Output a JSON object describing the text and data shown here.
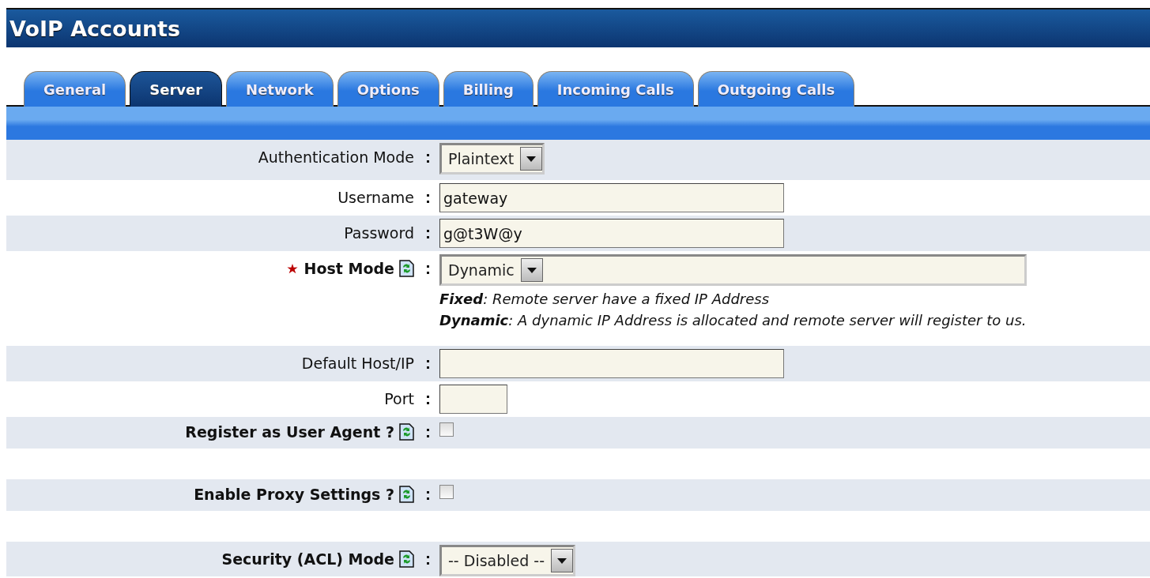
{
  "window": {
    "title": "VoIP Accounts"
  },
  "tabs": [
    {
      "label": "General",
      "selected": false
    },
    {
      "label": "Server",
      "selected": true
    },
    {
      "label": "Network",
      "selected": false
    },
    {
      "label": "Options",
      "selected": false
    },
    {
      "label": "Billing",
      "selected": false
    },
    {
      "label": "Incoming Calls",
      "selected": false
    },
    {
      "label": "Outgoing Calls",
      "selected": false
    }
  ],
  "fields": [
    {
      "kind": "select",
      "label": "Authentication Mode",
      "bold": false,
      "required": false,
      "help": false,
      "value": "Plaintext"
    },
    {
      "kind": "text",
      "label": "Username",
      "bold": false,
      "required": false,
      "help": false,
      "value": "gateway"
    },
    {
      "kind": "text",
      "label": "Password",
      "bold": false,
      "required": false,
      "help": false,
      "value": "g@t3W@y"
    },
    {
      "kind": "select",
      "label": "Host Mode",
      "bold": true,
      "required": true,
      "help": true,
      "value": "Dynamic",
      "notes": [
        "**Fixed**: Remote server have a fixed IP Address",
        "**Dynamic**: A dynamic IP Address is allocated and remote server will register to us."
      ]
    },
    {
      "kind": "text",
      "label": "Default Host/IP",
      "bold": false,
      "required": false,
      "help": false
    },
    {
      "kind": "port",
      "label": "Port",
      "bold": false,
      "required": false,
      "help": false
    },
    {
      "kind": "checkbox",
      "label": "Register as User Agent ?",
      "bold": true,
      "required": false,
      "help": true,
      "checked": false
    },
    {
      "kind": "checkbox",
      "label": "Enable Proxy Settings ?",
      "bold": true,
      "required": false,
      "help": true,
      "checked": false
    },
    {
      "kind": "select",
      "label": "Security (ACL) Mode",
      "bold": true,
      "required": false,
      "help": true,
      "value": "-- Disabled --"
    }
  ]
}
